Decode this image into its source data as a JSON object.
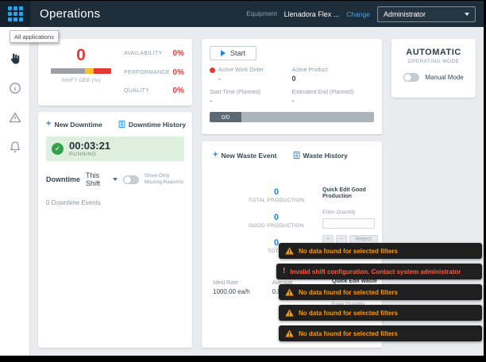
{
  "topbar": {
    "title": "Operations",
    "equipment_label": "Equipment",
    "equipment_value": "Llenadora Flex ...",
    "change_label": "Change",
    "user_value": "Administrator"
  },
  "tooltip": {
    "text": "All applications"
  },
  "sidebar": {
    "icons": [
      "operations",
      "info",
      "alerts",
      "notifications"
    ]
  },
  "glyphs": {
    "plus": "+",
    "minus": "−",
    "check": "✓",
    "exclaim": "!"
  },
  "oee": {
    "value": "0",
    "gauge_label": "SHIFT OEE (%)",
    "gauge_segments": [
      {
        "color": "#9aa0a6",
        "pct": 57
      },
      {
        "color": "#fbc02d",
        "pct": 14
      },
      {
        "color": "#e53935",
        "pct": 29
      }
    ],
    "metrics": [
      {
        "label": "AVAILABILITY",
        "value": "0%"
      },
      {
        "label": "PERFORMANCE",
        "value": "0%"
      },
      {
        "label": "QUALITY",
        "value": "0%"
      }
    ]
  },
  "downtime": {
    "new_downtime": "New Downtime",
    "history": "Downtime History",
    "timer": "00:03:21",
    "status": "RUNNING",
    "filter_title": "Downtime",
    "shift_filter": "This Shift",
    "toggle_label": "Show Only Missing Reasons",
    "events_summary": "0 Downtime Events"
  },
  "workorder": {
    "start": "Start",
    "active_wo_label": "Active Work Order",
    "active_wo_value": "-",
    "active_product_label": "Active Product",
    "active_product_value": "0",
    "start_planned_label": "Start Time (Planned)",
    "start_planned_value": "-",
    "end_planned_label": "Estimated End (Planned)",
    "end_planned_value": "-",
    "progress": "0/0"
  },
  "production": {
    "new_waste": "New Waste Event",
    "waste_history": "Waste History",
    "stats": [
      {
        "value": "0",
        "label": "TOTAL PRODUCTION"
      },
      {
        "value": "0",
        "label": "GOOD PRODUCTION"
      },
      {
        "value": "0",
        "label": "TOTAL"
      }
    ],
    "quick_good_title": "Quick Edit Good Production",
    "enter_quantity": "Enter Quantity",
    "reject": "Reject",
    "ideal_rate_label": "Ideal Rate",
    "ideal_rate_value": "1000.00 ea/h",
    "average_label": "Average",
    "average_value": "0.00 ea/h",
    "quick_waste_title": "Quick Edit Waste"
  },
  "mode": {
    "title": "AUTOMATIC",
    "subtitle": "OPERATING MODE",
    "toggle_label": "Manual Mode"
  },
  "toasts": [
    {
      "type": "warning",
      "text": "No data found for selected filters"
    },
    {
      "type": "error",
      "text": "Invalid shift configuration. Contact system administrator"
    },
    {
      "type": "warning",
      "text": "No data found for selected filters"
    },
    {
      "type": "warning",
      "text": "No data found for selected filters"
    },
    {
      "type": "warning",
      "text": "No data found for selected filters"
    }
  ],
  "colors": {
    "topbar_bg": "#1d2d3a",
    "accent_blue": "#1e88e5",
    "alert_red": "#e53935",
    "running_green": "#34a04a",
    "warning_orange": "#ff9800",
    "error_orange_red": "#ff5a3c",
    "toast_bg": "#1f1f1f"
  }
}
